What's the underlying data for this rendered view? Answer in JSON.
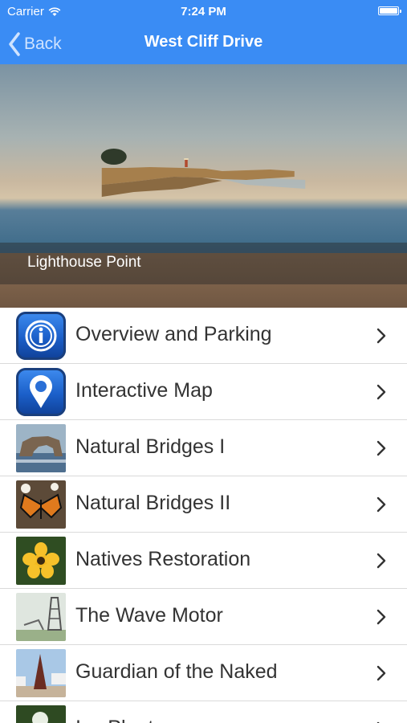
{
  "status": {
    "carrier": "Carrier",
    "time": "7:24 PM"
  },
  "nav": {
    "back_label": "Back",
    "title": "West Cliff Drive"
  },
  "hero": {
    "caption": "Lighthouse Point"
  },
  "list": {
    "items": [
      {
        "label": "Overview and Parking",
        "thumb": "info-icon"
      },
      {
        "label": "Interactive Map",
        "thumb": "map-pin-icon"
      },
      {
        "label": "Natural Bridges I",
        "thumb": "rock-arch-photo"
      },
      {
        "label": "Natural Bridges II",
        "thumb": "monarch-butterfly-photo"
      },
      {
        "label": "Natives Restoration",
        "thumb": "yellow-flower-photo"
      },
      {
        "label": "The Wave Motor",
        "thumb": "tower-photo"
      },
      {
        "label": "Guardian of the Naked",
        "thumb": "sculpture-photo"
      },
      {
        "label": "Ice Plant",
        "thumb": "ice-plant-photo"
      }
    ]
  },
  "colors": {
    "nav_bar": "#3a8cf4",
    "row_text": "#333333",
    "separator": "#dadada"
  }
}
